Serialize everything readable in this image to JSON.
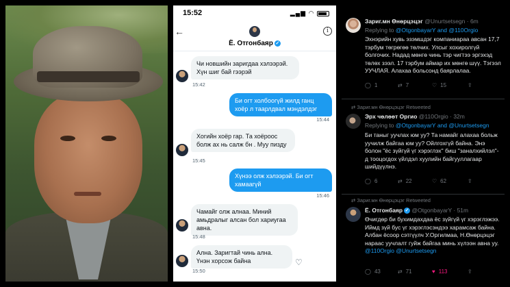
{
  "phone": {
    "status_time": "15:52",
    "contact_name": "Ё. Отгонбаяр",
    "messages": [
      {
        "dir": "in",
        "text": "Чи новшийн заригдаа хэлээрэй. Хүн шиг бай гээрэй",
        "time": "15:42"
      },
      {
        "dir": "out",
        "text": "Би огт холбоогүй жилд ганц хоёр л таарлдвал мэндэлдэг",
        "time": "15:44"
      },
      {
        "dir": "in",
        "text": "Хогийн хоёр гар. Та хоёроос болж ах нь салж бн . Муу пизду",
        "time": "15:45"
      },
      {
        "dir": "out",
        "text": "Хүнээ олж хэлээрэй. Би огт хамаагүй",
        "time": "15:46"
      },
      {
        "dir": "in",
        "text": "Чамайг олж алнаа. Миний амьдралыг алсан бол хариугаа авна.",
        "time": "15:48"
      },
      {
        "dir": "in",
        "text": "Ална. Заригтай чинь ална. Үнэн хорсож байна",
        "time": "15:50"
      }
    ]
  },
  "twitter": {
    "tweets": [
      {
        "name": "Зариг.мн Өнөрцэцэг",
        "handle": "@Unurtsetsegn · 6m",
        "replying_prefix": "Replying to ",
        "replying_to": "@OtgonbayarY and @110Orgio",
        "body": "Эхнэрийн хувь эзэмшдэг компаниараа авсан 17,7 тэрбум төгрөгөө төлчих. Улсыг хохиролгүй болгочих. Надад мөнгө чинь тэр чигтээ эргэхэд төлөх зээл. 17 тэрбум аймар их мөнгө шүү. Тэгээл УУЧЛАЯ. Алахаа больсонд баярлалаа.",
        "reply_count": "1",
        "retweet_count": "7",
        "like_count": "15"
      },
      {
        "retweeted_by": "Зариг.мн Өнөрцэцэг Retweeted",
        "name": "Эрх чөлөөт Оргио",
        "handle": "@110Orgio · 32m",
        "replying_prefix": "Replying to ",
        "replying_to": "@OtgonbayarY and @Unurtsetsegn",
        "body": "Би таныг уучлах юм уу? Та намайг алахаа больж уучилж байгаа юм уу? Ойлгохгүй байна. Энэ болон \"ёс зүйгүй үг хэрэглэх\" биш \"заналхийлэл\"-д тооцогдох үйлдэл хуулийн байгууллагаар шийдүүлнэ.",
        "reply_count": "6",
        "retweet_count": "22",
        "like_count": "62"
      },
      {
        "retweeted_by": "Зариг.мн Өнөрцэцэг Retweeted",
        "name": "Ё. Отгонбаяр",
        "handle": "@OtgonbayarY · 51m",
        "body_plain": "Өчигдөр би бухимдахдаа ёс зүйгүй үг хэрэглэжээ. Иймд зүй бус үг хэрэглэсэндээ харамсаж байна. Албан ёсоор сэтгүүлч У.Оргилмаа, Н.Өнөрцэцэг нараас уучлалт гуйж байгаа минь хүлээн авна уу.",
        "mention1": "@110Orgio",
        "mention2": "@Unurtsetsegn",
        "reply_count": "43",
        "retweet_count": "71",
        "like_count": "113"
      }
    ]
  }
}
